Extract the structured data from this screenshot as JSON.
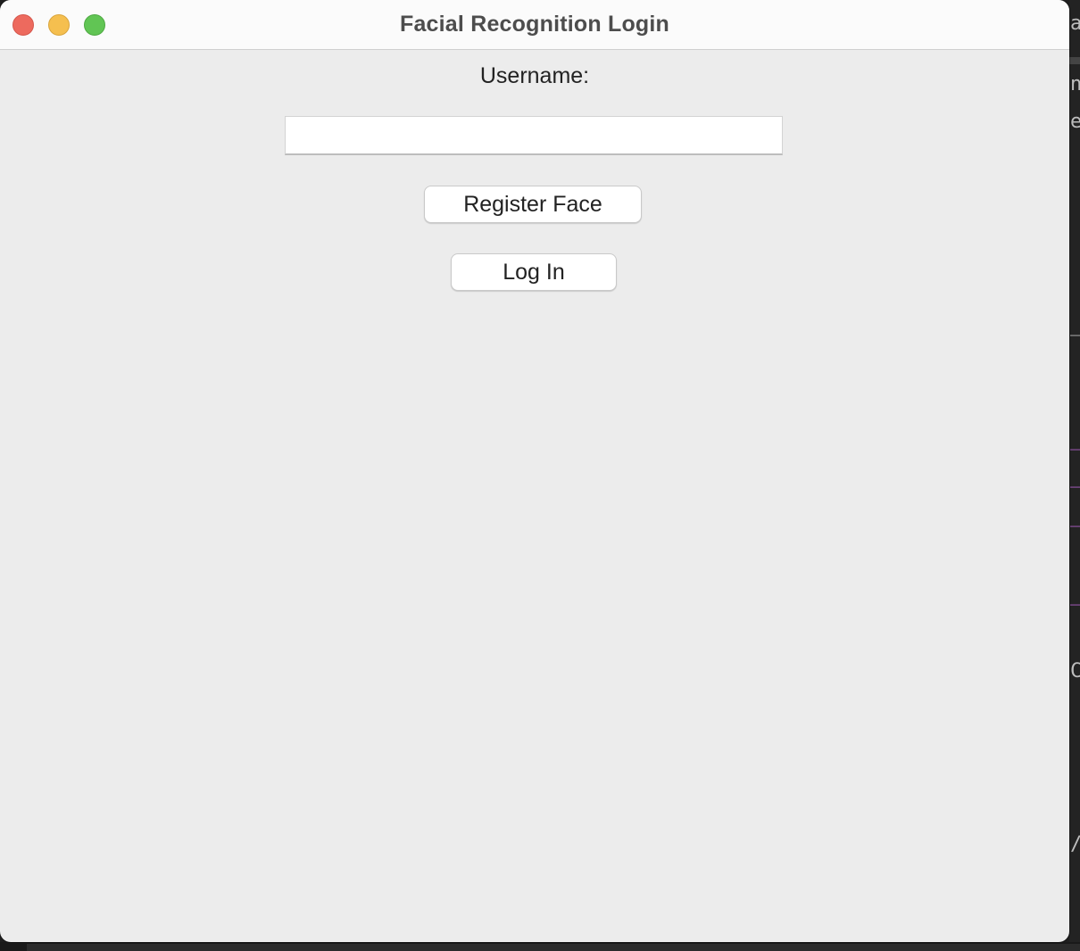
{
  "window": {
    "title": "Facial Recognition Login"
  },
  "form": {
    "username_label": "Username:",
    "username_value": "",
    "username_placeholder": "",
    "register_button_label": "Register Face",
    "login_button_label": "Log In"
  },
  "background_editor": {
    "visible_glyphs": [
      "a",
      "nt",
      "er",
      "_i",
      "_n",
      "_t",
      "_t",
      "_t",
      "Cr",
      "/"
    ]
  },
  "colors": {
    "close": "#ed6a5e",
    "minimize": "#f5bf4f",
    "zoom": "#61c554",
    "window_bg": "#ececec"
  }
}
